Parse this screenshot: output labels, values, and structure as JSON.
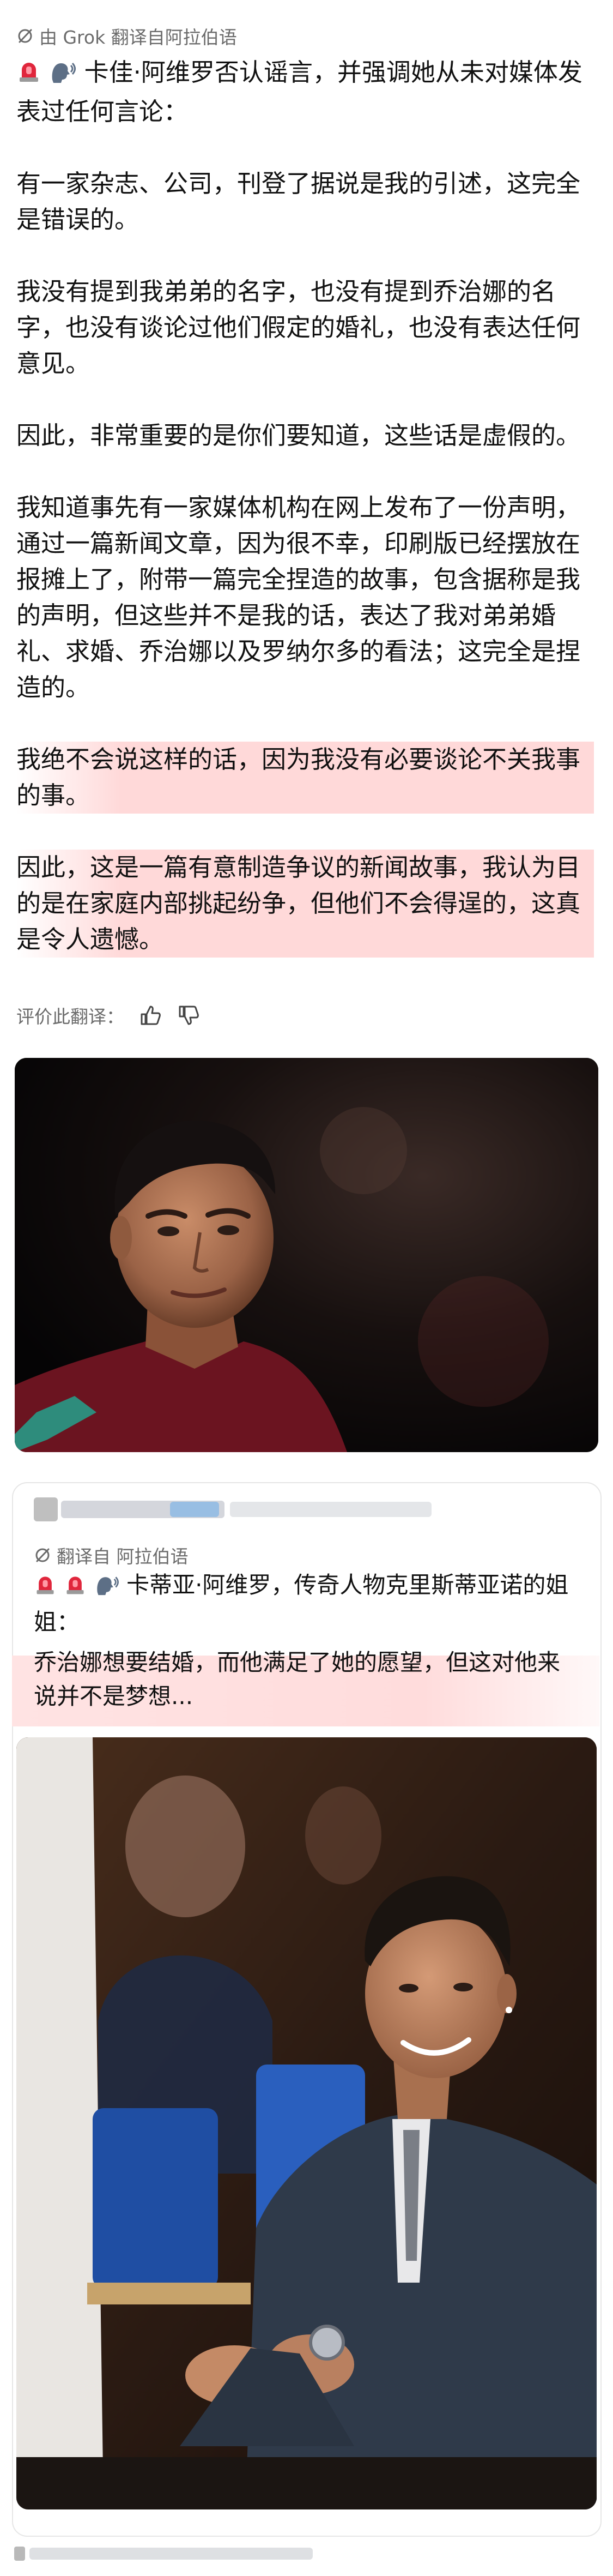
{
  "translation_note": "由 Grok 翻译自阿拉伯语",
  "post": {
    "header_emojis": [
      "siren-emoji",
      "speaking-head-emoji"
    ],
    "paragraphs": [
      "卡佳·阿维罗否认谣言，并强调她从未对媒体发表过任何言论：",
      "有一家杂志、公司，刊登了据说是我的引述，这完全是错误的。",
      "我没有提到我弟弟的名字，也没有提到乔治娜的名字，也没有谈论过他们假定的婚礼，也没有表达任何意见。",
      "因此，非常重要的是你们要知道，这些话是虚假的。",
      "我知道事先有一家媒体机构在网上发布了一份声明，通过一篇新闻文章，因为很不幸，印刷版已经摆放在报摊上了，附带一篇完全捏造的故事，包含据称是我的声明，但这些并不是我的话，表达了我对弟弟婚礼、求婚、乔治娜以及罗纳尔多的看法；这完全是捏造的。",
      "我绝不会说这样的话，因为我没有必要谈论不关我事的事。",
      "因此，这是一篇有意制造争议的新闻故事，我认为目的是在家庭内部挑起纷争，但他们不会得逞的，这真是令人遗憾。"
    ]
  },
  "rate_translation_label": "评价此翻译：",
  "quoted_post": {
    "translation_note": "翻译自 阿拉伯语",
    "header": "卡蒂亚·阿维罗，传奇人物克里斯蒂亚诺的姐姐：",
    "body": "乔治娜想要结婚，而他满足了她的愿望，但这对他来说并不是梦想..."
  },
  "colors": {
    "highlight": "#ffd9d9",
    "muted_text": "#6b6b6b",
    "card_border": "#e6e6e6"
  }
}
